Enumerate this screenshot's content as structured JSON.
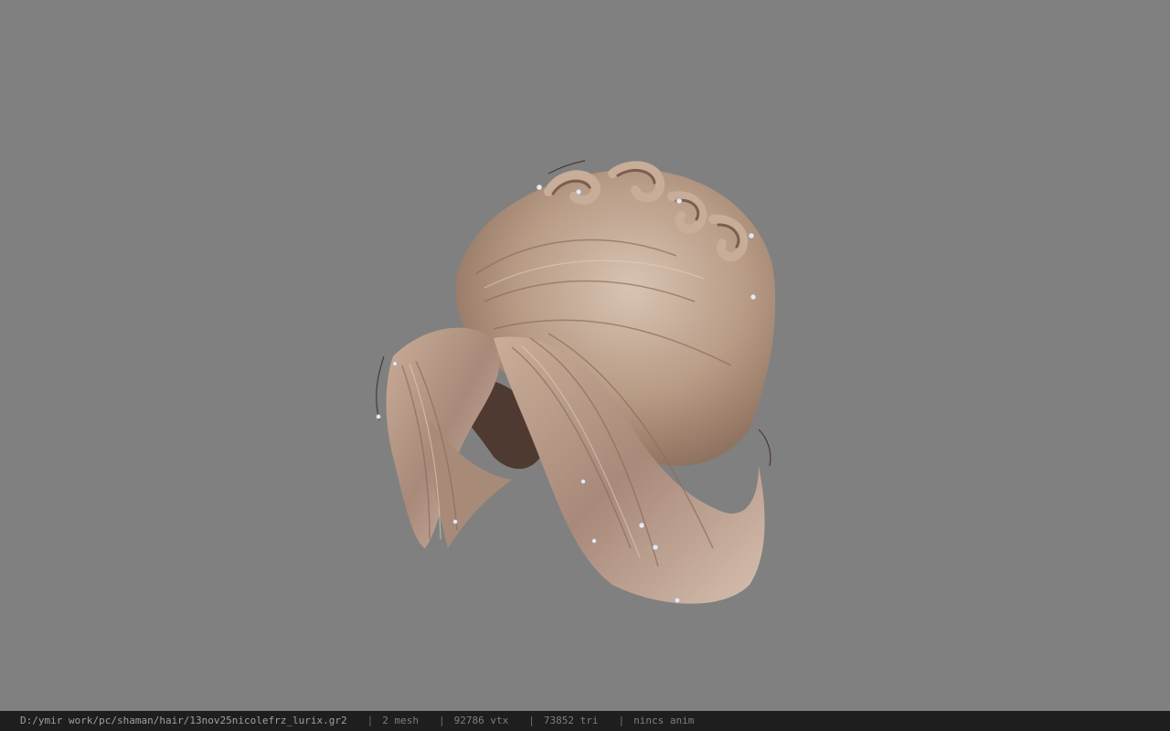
{
  "viewport": {
    "background_color": "#808080",
    "model_description_icon": "hair-mesh-model"
  },
  "status_bar": {
    "file_path": "D:/ymir work/pc/shaman/hair/13nov25nicolefrz_lurix.gr2",
    "separator": "|",
    "mesh_count": "2 mesh",
    "vertex_count": "92786 vtx",
    "triangle_count": "73852 tri",
    "anim_status": "nincs anim"
  },
  "colors": {
    "hair_base": "#b89c86",
    "hair_light": "#d4bcaa",
    "hair_dark": "#6e5444",
    "statusbar_bg": "#1e1e1e",
    "statusbar_text": "#8c8c8c"
  }
}
